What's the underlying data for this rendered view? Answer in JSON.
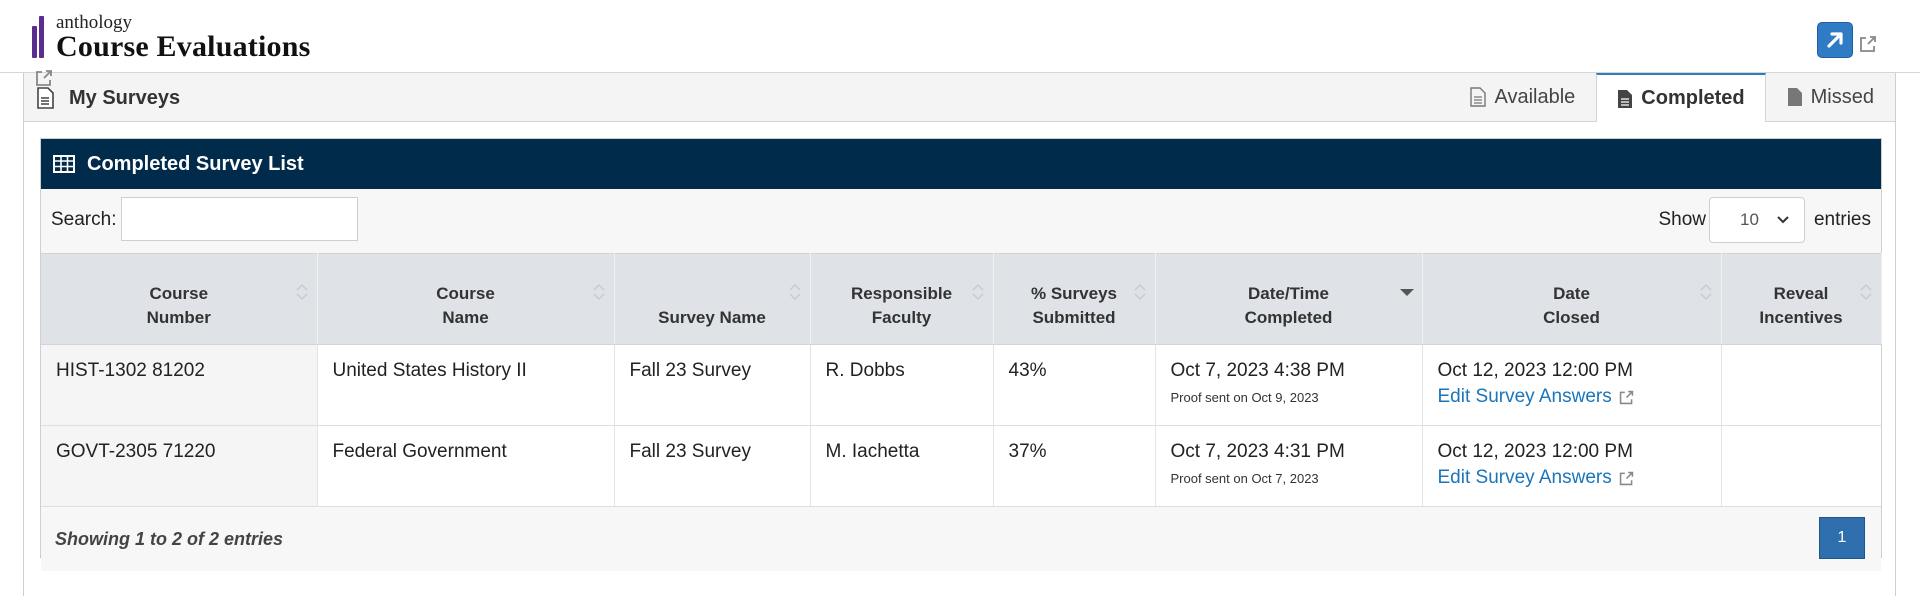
{
  "brand": {
    "company": "anthology",
    "product": "Course Evaluations",
    "accent_color": "#5b2d8e"
  },
  "header": {
    "expand_icon": "arrow-up-right-icon",
    "external_icon": "external-link-icon"
  },
  "panel": {
    "title": "My Surveys",
    "title_icon": "document-icon",
    "tabs": [
      {
        "label": "Available",
        "icon": "document-outline-icon",
        "active": false
      },
      {
        "label": "Completed",
        "icon": "document-solid-icon",
        "active": true
      },
      {
        "label": "Missed",
        "icon": "document-solid-icon",
        "active": false
      }
    ]
  },
  "card": {
    "title": "Completed Survey List",
    "title_icon": "table-icon",
    "header_color": "#002b4b"
  },
  "controls": {
    "search_label": "Search:",
    "search_value": "",
    "show_label": "Show",
    "page_size": "10",
    "entries_label": "entries"
  },
  "table": {
    "columns": [
      {
        "line1": "Course",
        "line2": "Number",
        "sort": "none"
      },
      {
        "line1": "Course",
        "line2": "Name",
        "sort": "none"
      },
      {
        "line1": "",
        "line2": "Survey Name",
        "sort": "none"
      },
      {
        "line1": "Responsible",
        "line2": "Faculty",
        "sort": "none"
      },
      {
        "line1": "% Surveys",
        "line2": "Submitted",
        "sort": "none"
      },
      {
        "line1": "Date/Time",
        "line2": "Completed",
        "sort": "desc"
      },
      {
        "line1": "Date",
        "line2": "Closed",
        "sort": "none"
      },
      {
        "line1": "Reveal",
        "line2": "Incentives",
        "sort": "none"
      }
    ],
    "rows": [
      {
        "course_number": "HIST-1302 81202",
        "course_name": "United States History II",
        "survey_name": "Fall 23 Survey",
        "faculty": "R. Dobbs",
        "percent": "43%",
        "completed": "Oct 7, 2023 4:38 PM",
        "proof": "Proof sent on Oct 9, 2023",
        "closed": "Oct 12, 2023 12:00 PM",
        "edit_label": "Edit Survey Answers",
        "incentives": ""
      },
      {
        "course_number": "GOVT-2305 71220",
        "course_name": "Federal Government",
        "survey_name": "Fall 23 Survey",
        "faculty": "M. Iachetta",
        "percent": "37%",
        "completed": "Oct 7, 2023 4:31 PM",
        "proof": "Proof sent on Oct 7, 2023",
        "closed": "Oct 12, 2023 12:00 PM",
        "edit_label": "Edit Survey Answers",
        "incentives": ""
      }
    ]
  },
  "footer": {
    "summary": "Showing 1 to 2 of 2 entries",
    "current_page": "1"
  }
}
